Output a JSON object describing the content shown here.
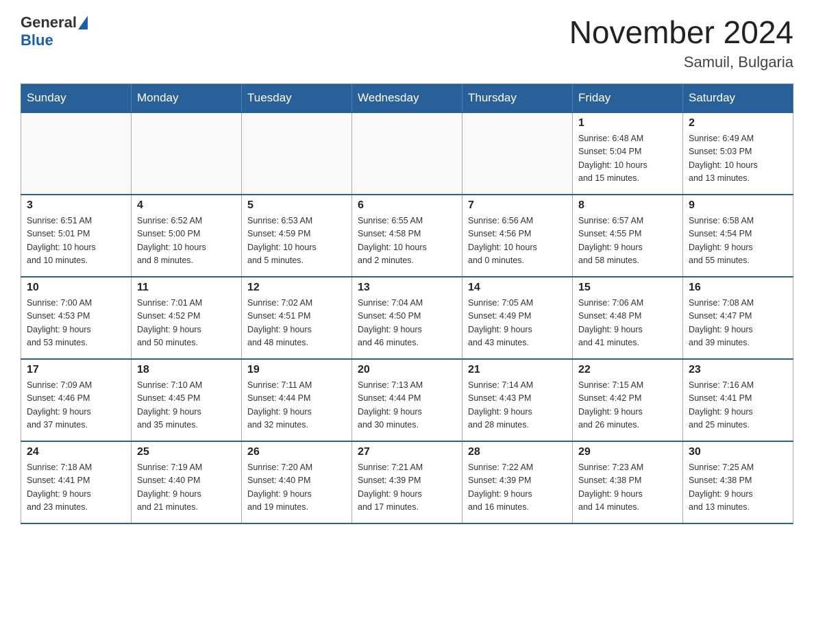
{
  "header": {
    "logo_general": "General",
    "logo_blue": "Blue",
    "title": "November 2024",
    "subtitle": "Samuil, Bulgaria"
  },
  "weekdays": [
    "Sunday",
    "Monday",
    "Tuesday",
    "Wednesday",
    "Thursday",
    "Friday",
    "Saturday"
  ],
  "weeks": [
    [
      {
        "day": "",
        "info": ""
      },
      {
        "day": "",
        "info": ""
      },
      {
        "day": "",
        "info": ""
      },
      {
        "day": "",
        "info": ""
      },
      {
        "day": "",
        "info": ""
      },
      {
        "day": "1",
        "info": "Sunrise: 6:48 AM\nSunset: 5:04 PM\nDaylight: 10 hours\nand 15 minutes."
      },
      {
        "day": "2",
        "info": "Sunrise: 6:49 AM\nSunset: 5:03 PM\nDaylight: 10 hours\nand 13 minutes."
      }
    ],
    [
      {
        "day": "3",
        "info": "Sunrise: 6:51 AM\nSunset: 5:01 PM\nDaylight: 10 hours\nand 10 minutes."
      },
      {
        "day": "4",
        "info": "Sunrise: 6:52 AM\nSunset: 5:00 PM\nDaylight: 10 hours\nand 8 minutes."
      },
      {
        "day": "5",
        "info": "Sunrise: 6:53 AM\nSunset: 4:59 PM\nDaylight: 10 hours\nand 5 minutes."
      },
      {
        "day": "6",
        "info": "Sunrise: 6:55 AM\nSunset: 4:58 PM\nDaylight: 10 hours\nand 2 minutes."
      },
      {
        "day": "7",
        "info": "Sunrise: 6:56 AM\nSunset: 4:56 PM\nDaylight: 10 hours\nand 0 minutes."
      },
      {
        "day": "8",
        "info": "Sunrise: 6:57 AM\nSunset: 4:55 PM\nDaylight: 9 hours\nand 58 minutes."
      },
      {
        "day": "9",
        "info": "Sunrise: 6:58 AM\nSunset: 4:54 PM\nDaylight: 9 hours\nand 55 minutes."
      }
    ],
    [
      {
        "day": "10",
        "info": "Sunrise: 7:00 AM\nSunset: 4:53 PM\nDaylight: 9 hours\nand 53 minutes."
      },
      {
        "day": "11",
        "info": "Sunrise: 7:01 AM\nSunset: 4:52 PM\nDaylight: 9 hours\nand 50 minutes."
      },
      {
        "day": "12",
        "info": "Sunrise: 7:02 AM\nSunset: 4:51 PM\nDaylight: 9 hours\nand 48 minutes."
      },
      {
        "day": "13",
        "info": "Sunrise: 7:04 AM\nSunset: 4:50 PM\nDaylight: 9 hours\nand 46 minutes."
      },
      {
        "day": "14",
        "info": "Sunrise: 7:05 AM\nSunset: 4:49 PM\nDaylight: 9 hours\nand 43 minutes."
      },
      {
        "day": "15",
        "info": "Sunrise: 7:06 AM\nSunset: 4:48 PM\nDaylight: 9 hours\nand 41 minutes."
      },
      {
        "day": "16",
        "info": "Sunrise: 7:08 AM\nSunset: 4:47 PM\nDaylight: 9 hours\nand 39 minutes."
      }
    ],
    [
      {
        "day": "17",
        "info": "Sunrise: 7:09 AM\nSunset: 4:46 PM\nDaylight: 9 hours\nand 37 minutes."
      },
      {
        "day": "18",
        "info": "Sunrise: 7:10 AM\nSunset: 4:45 PM\nDaylight: 9 hours\nand 35 minutes."
      },
      {
        "day": "19",
        "info": "Sunrise: 7:11 AM\nSunset: 4:44 PM\nDaylight: 9 hours\nand 32 minutes."
      },
      {
        "day": "20",
        "info": "Sunrise: 7:13 AM\nSunset: 4:44 PM\nDaylight: 9 hours\nand 30 minutes."
      },
      {
        "day": "21",
        "info": "Sunrise: 7:14 AM\nSunset: 4:43 PM\nDaylight: 9 hours\nand 28 minutes."
      },
      {
        "day": "22",
        "info": "Sunrise: 7:15 AM\nSunset: 4:42 PM\nDaylight: 9 hours\nand 26 minutes."
      },
      {
        "day": "23",
        "info": "Sunrise: 7:16 AM\nSunset: 4:41 PM\nDaylight: 9 hours\nand 25 minutes."
      }
    ],
    [
      {
        "day": "24",
        "info": "Sunrise: 7:18 AM\nSunset: 4:41 PM\nDaylight: 9 hours\nand 23 minutes."
      },
      {
        "day": "25",
        "info": "Sunrise: 7:19 AM\nSunset: 4:40 PM\nDaylight: 9 hours\nand 21 minutes."
      },
      {
        "day": "26",
        "info": "Sunrise: 7:20 AM\nSunset: 4:40 PM\nDaylight: 9 hours\nand 19 minutes."
      },
      {
        "day": "27",
        "info": "Sunrise: 7:21 AM\nSunset: 4:39 PM\nDaylight: 9 hours\nand 17 minutes."
      },
      {
        "day": "28",
        "info": "Sunrise: 7:22 AM\nSunset: 4:39 PM\nDaylight: 9 hours\nand 16 minutes."
      },
      {
        "day": "29",
        "info": "Sunrise: 7:23 AM\nSunset: 4:38 PM\nDaylight: 9 hours\nand 14 minutes."
      },
      {
        "day": "30",
        "info": "Sunrise: 7:25 AM\nSunset: 4:38 PM\nDaylight: 9 hours\nand 13 minutes."
      }
    ]
  ]
}
